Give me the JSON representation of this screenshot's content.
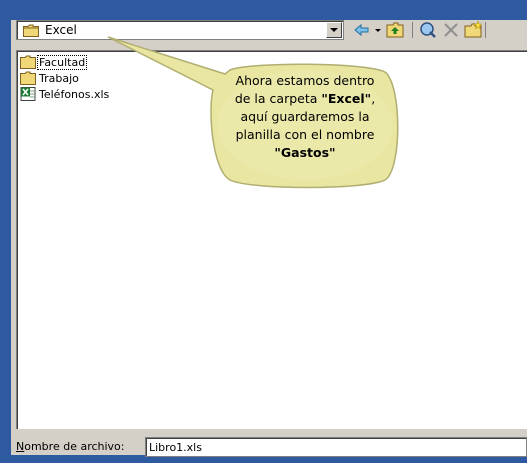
{
  "location": {
    "folder": "Excel"
  },
  "files": [
    {
      "name": "Facultad",
      "icon": "folder-icon"
    },
    {
      "name": "Trabajo",
      "icon": "folder-icon"
    },
    {
      "name": "Teléfonos.xls",
      "icon": "excel-file-icon"
    }
  ],
  "callout": {
    "line1": "Ahora estamos dentro",
    "line2_pre": "de la carpeta ",
    "line2_bold": "\"Excel\"",
    "line2_post": ",",
    "line3": "aquí guardaremos la",
    "line4": "planilla con el nombre",
    "line5_bold": "\"Gastos\""
  },
  "filename": {
    "label_mnemonic": "N",
    "label_rest": "ombre de archivo:",
    "value": "Libro1.xls"
  },
  "colors": {
    "frame": "#2d5aa0",
    "dialog": "#d4d0c8",
    "callout_fill": "#e8e6a0",
    "callout_stroke": "#b0ae70"
  }
}
